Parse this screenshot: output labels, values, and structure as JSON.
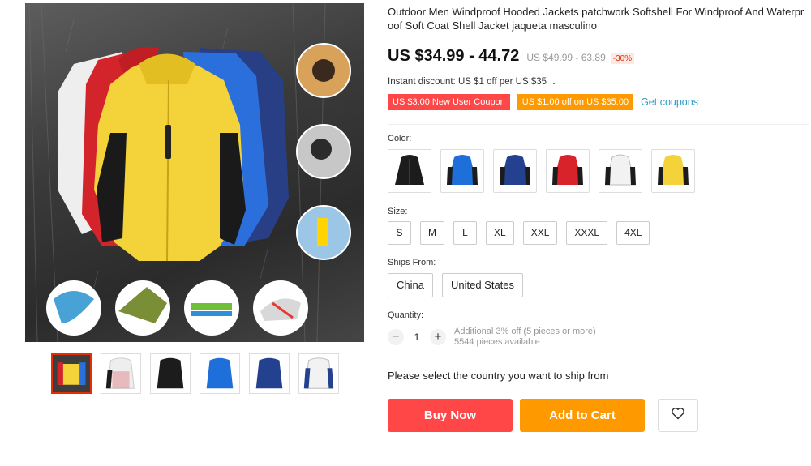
{
  "product": {
    "title": "Outdoor Men Windproof Hooded Jackets patchwork Softshell For Windproof And Waterproof Soft Coat Shell Jacket jaqueta masculino",
    "price": "US $34.99 - 44.72",
    "original_price": "US $49.99 - 63.89",
    "discount": "-30%",
    "instant_discount": "Instant discount: US $1 off per US $35",
    "instant_discount_icon": "chevron-down-icon"
  },
  "coupons": [
    {
      "label": "US $3.00 New User Coupon",
      "color": "#ff4747"
    },
    {
      "label": "US $1.00 off on US $35.00",
      "color": "#ff9900"
    }
  ],
  "get_coupons_label": "Get coupons",
  "color": {
    "label": "Color:",
    "options": [
      {
        "name": "black",
        "fill": "#1c1c1c"
      },
      {
        "name": "sky-blue",
        "fill": "#1e6fd9"
      },
      {
        "name": "navy",
        "fill": "#23418f"
      },
      {
        "name": "red",
        "fill": "#d9232b"
      },
      {
        "name": "white",
        "fill": "#f2f2f2"
      },
      {
        "name": "yellow",
        "fill": "#f4d23a"
      }
    ]
  },
  "size": {
    "label": "Size:",
    "options": [
      "S",
      "M",
      "L",
      "XL",
      "XXL",
      "XXXL",
      "4XL"
    ]
  },
  "ships_from": {
    "label": "Ships From:",
    "options": [
      "China",
      "United States"
    ]
  },
  "quantity": {
    "label": "Quantity:",
    "value": "1",
    "minus": "−",
    "plus": "+",
    "additional": "Additional 3% off (5 pieces or more)",
    "available": "5544 pieces available"
  },
  "ship_message": "Please select the country you want to ship from",
  "buttons": {
    "buy_now": "Buy Now",
    "add_to_cart": "Add to Cart",
    "wishlist_icon": "heart-icon"
  },
  "colors": {
    "accent_red": "#ff4747",
    "accent_orange": "#ff9900",
    "link_blue": "#2e9cc3"
  },
  "gallery": {
    "thumbnail_count": 6,
    "active_thumbnail": 0
  }
}
